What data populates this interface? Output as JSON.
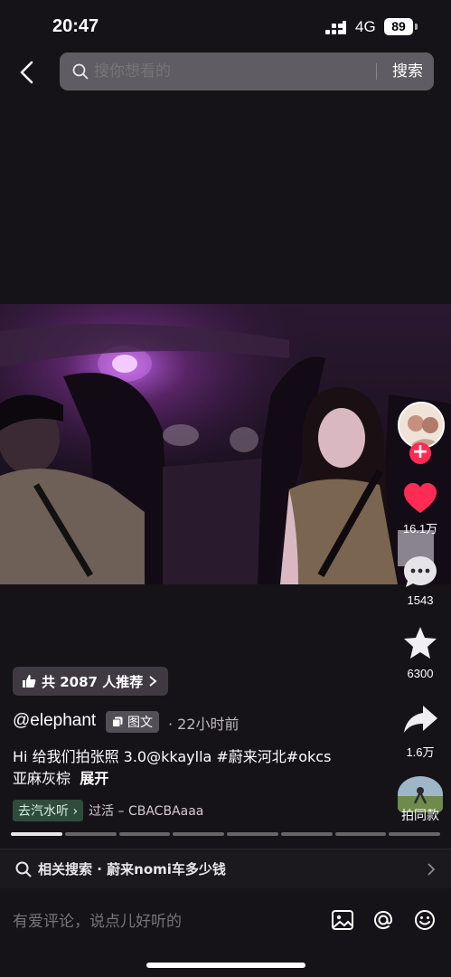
{
  "status_bar": {
    "time": "20:47",
    "network": "4G",
    "battery": "89"
  },
  "header": {
    "search_placeholder": "搜你想看的",
    "search_button": "搜索"
  },
  "actions": {
    "likes": "16.1万",
    "comments": "1543",
    "favorites": "6300",
    "shares": "1.6万",
    "same_style": "拍同款"
  },
  "post": {
    "recommend_label": "共 2087 人推荐",
    "author": "@elephant",
    "type_badge": "图文",
    "time": "· 22小时前",
    "caption_line1": "Hi 给我们拍张照 3.0@kkaylla #蔚来河北#okcs",
    "caption_line2": "亚麻灰棕",
    "expand": "展开",
    "music_chip": "去汽水听",
    "music_text": "过活 – CBACBAaaa"
  },
  "progress": {
    "segments": 8,
    "active_index": 0
  },
  "related": {
    "label": "相关搜索 · 蔚来nomi车多少钱"
  },
  "comment_bar": {
    "placeholder": "有爱评论，说点儿好听的"
  },
  "colors": {
    "accent": "#fe2c55",
    "background": "#161318",
    "music_chip": "#2f4b3a"
  }
}
